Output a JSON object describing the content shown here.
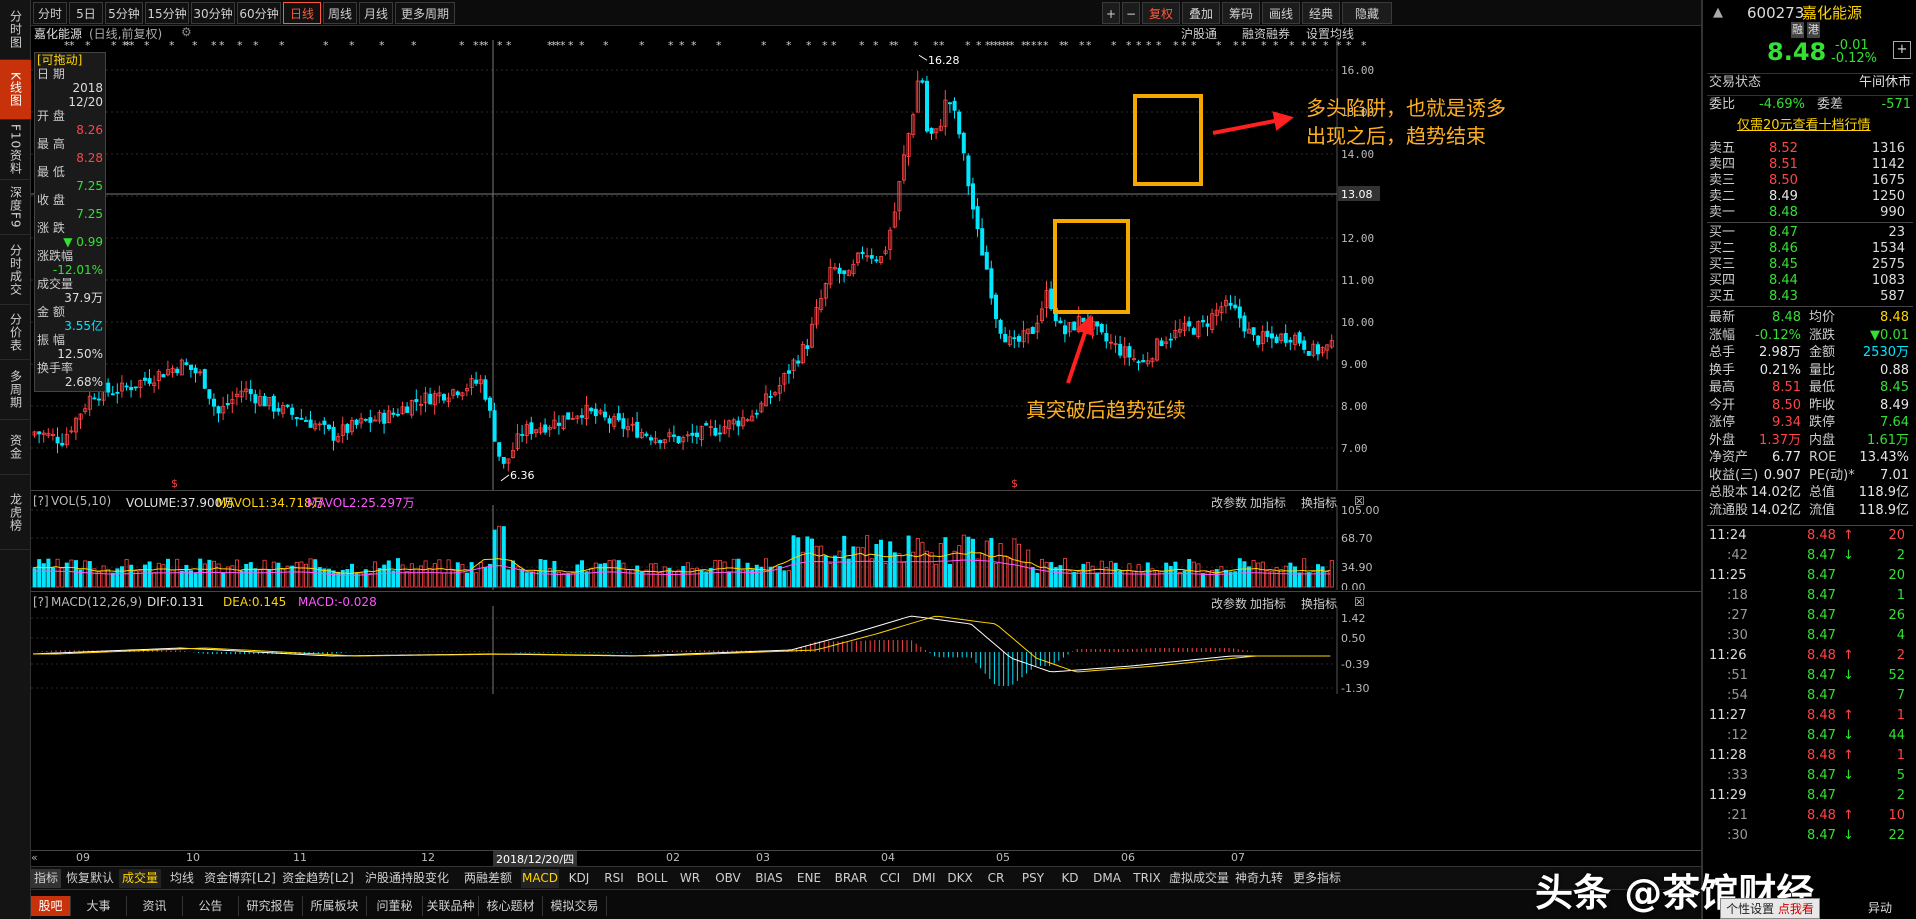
{
  "left_toolbar": [
    "分时图",
    "K线图",
    "F10资料",
    "深度F9",
    "分时成交",
    "分价表",
    "多周期",
    "资金",
    "龙虎榜"
  ],
  "top_periods": [
    "分时",
    "5日",
    "5分钟",
    "15分钟",
    "30分钟",
    "60分钟",
    "日线",
    "周线",
    "月线",
    "更多周期"
  ],
  "top_right_buttons": [
    "+",
    "−",
    "复权",
    "叠加",
    "筹码",
    "画线",
    "经典",
    "隐藏"
  ],
  "chart": {
    "stock_title": "嘉化能源",
    "mode": "(日线,前复权)",
    "links": [
      "沪股通",
      "融资融券",
      "设置均线"
    ],
    "price_axis": [
      "16.00",
      "15.00",
      "14.00",
      "13.00",
      "12.00",
      "11.00",
      "10.00",
      "9.00",
      "8.00",
      "7.00"
    ],
    "crosshair_price": "13.08",
    "high_label": "16.28",
    "low_label": "6.36",
    "crosshair_date": "2018/12/20/四",
    "x_months": [
      "09",
      "10",
      "11",
      "12",
      "02",
      "03",
      "04",
      "05",
      "06",
      "07"
    ]
  },
  "info_box": {
    "drag": "[可拖动]",
    "rows": [
      [
        "日  期",
        ""
      ],
      [
        "",
        "2018"
      ],
      [
        "",
        "12/20"
      ],
      [
        "开  盘",
        ""
      ],
      [
        "",
        "8.26"
      ],
      [
        "最  高",
        ""
      ],
      [
        "",
        "8.28"
      ],
      [
        "最  低",
        ""
      ],
      [
        "",
        "7.25"
      ],
      [
        "收  盘",
        ""
      ],
      [
        "",
        "7.25"
      ],
      [
        "涨  跌",
        ""
      ],
      [
        "",
        "▼ 0.99"
      ],
      [
        "涨跌幅",
        ""
      ],
      [
        "",
        "-12.01%"
      ],
      [
        "成交量",
        ""
      ],
      [
        "",
        "37.9万"
      ],
      [
        "金  额",
        ""
      ],
      [
        "",
        "3.55亿"
      ],
      [
        "振  幅",
        ""
      ],
      [
        "",
        "12.50%"
      ],
      [
        "换手率",
        ""
      ],
      [
        "",
        "2.68%"
      ]
    ]
  },
  "vol_pane": {
    "title": "VOL(5,10)",
    "volume": "VOLUME:37.900万",
    "mavol1": "MAVOL1:34.718万",
    "mavol2": "MAVOL2:25.297万",
    "axis": [
      "105.00",
      "68.70",
      "34.90",
      "0.00"
    ],
    "tools": [
      "改参数",
      "加指标",
      "换指标"
    ]
  },
  "macd_pane": {
    "title": "MACD(12,26,9)",
    "dif": "DIF:0.131",
    "dea": "DEA:0.145",
    "macd": "MACD:-0.028",
    "axis": [
      "1.42",
      "0.50",
      "-0.39",
      "-1.30"
    ],
    "tools": [
      "改参数",
      "加指标",
      "换指标"
    ]
  },
  "annotations": {
    "top": "多头陷阱，也就是诱多\n出现之后，趋势结束",
    "bottom": "真突破后趋势延续"
  },
  "indicator_tabs": [
    "指标",
    "恢复默认",
    "成交量",
    "均线",
    "资金博弈[L2]",
    "资金趋势[L2]",
    "沪股通持股变化",
    "两融差额",
    "MACD",
    "KDJ",
    "RSI",
    "BOLL",
    "WR",
    "OBV",
    "BIAS",
    "ENE",
    "BRAR",
    "CCI",
    "DMI",
    "DKX",
    "CR",
    "PSY",
    "KD",
    "DMA",
    "TRIX",
    "虚拟成交量",
    "神奇九转",
    "更多指标"
  ],
  "footer_tabs": [
    "股吧",
    "大事",
    "资讯",
    "公告",
    "研究报告",
    "所属板块",
    "问董秘",
    "关联品种",
    "核心题材",
    "模拟交易"
  ],
  "quote": {
    "code": "600273",
    "name": "嘉化能源",
    "tags": [
      "融",
      "港"
    ],
    "price": "8.48",
    "change": "-0.01",
    "pct": "-0.12%",
    "status_label": "交易状态",
    "status": "午间休市",
    "weibi_label": "委比",
    "weibi": "-4.69%",
    "weicha_label": "委差",
    "weicha": "-571",
    "l10_link": "仅需20元查看十档行情",
    "asks": [
      [
        "卖五",
        "8.52",
        "1316"
      ],
      [
        "卖四",
        "8.51",
        "1142"
      ],
      [
        "卖三",
        "8.50",
        "1675"
      ],
      [
        "卖二",
        "8.49",
        "1250"
      ],
      [
        "卖一",
        "8.48",
        "990"
      ]
    ],
    "bids": [
      [
        "买一",
        "8.47",
        "23"
      ],
      [
        "买二",
        "8.46",
        "1534"
      ],
      [
        "买三",
        "8.45",
        "2575"
      ],
      [
        "买四",
        "8.44",
        "1083"
      ],
      [
        "买五",
        "8.43",
        "587"
      ]
    ],
    "stats": [
      [
        "最新",
        "8.48",
        "均价",
        "8.48"
      ],
      [
        "涨幅",
        "-0.12%",
        "涨跌",
        "▼0.01"
      ],
      [
        "总手",
        "2.98万",
        "金额",
        "2530万"
      ],
      [
        "换手",
        "0.21%",
        "量比",
        "0.88"
      ],
      [
        "最高",
        "8.51",
        "最低",
        "8.45"
      ],
      [
        "今开",
        "8.50",
        "昨收",
        "8.49"
      ],
      [
        "涨停",
        "9.34",
        "跌停",
        "7.64"
      ],
      [
        "外盘",
        "1.37万",
        "内盘",
        "1.61万"
      ],
      [
        "净资产",
        "6.77",
        "ROE",
        "13.43%"
      ],
      [
        "收益(三)",
        "0.907",
        "PE(动)*",
        "7.01"
      ],
      [
        "总股本",
        "14.02亿",
        "总值",
        "118.9亿"
      ],
      [
        "流通股",
        "14.02亿",
        "流值",
        "118.9亿"
      ]
    ],
    "ticks": [
      [
        "11:24",
        "8.48",
        "↑",
        "20"
      ],
      [
        ":42",
        "8.47",
        "↓",
        "2"
      ],
      [
        "11:25",
        "8.47",
        "",
        "20"
      ],
      [
        ":18",
        "8.47",
        "",
        "1"
      ],
      [
        ":27",
        "8.47",
        "",
        "26"
      ],
      [
        ":30",
        "8.47",
        "",
        "4"
      ],
      [
        "11:26",
        "8.48",
        "↑",
        "2"
      ],
      [
        ":51",
        "8.47",
        "↓",
        "52"
      ],
      [
        ":54",
        "8.47",
        "",
        "7"
      ],
      [
        "11:27",
        "8.48",
        "↑",
        "1"
      ],
      [
        ":12",
        "8.47",
        "↓",
        "44"
      ],
      [
        "11:28",
        "8.48",
        "↑",
        "1"
      ],
      [
        ":33",
        "8.47",
        "↓",
        "5"
      ],
      [
        "11:29",
        "8.47",
        "",
        "2"
      ],
      [
        ":21",
        "8.48",
        "↑",
        "10"
      ],
      [
        ":30",
        "8.47",
        "↓",
        "22"
      ]
    ]
  },
  "watermark": "头条 @茶馆财经",
  "bottom_right": [
    "个性设置",
    "点我看看",
    "异动"
  ]
}
